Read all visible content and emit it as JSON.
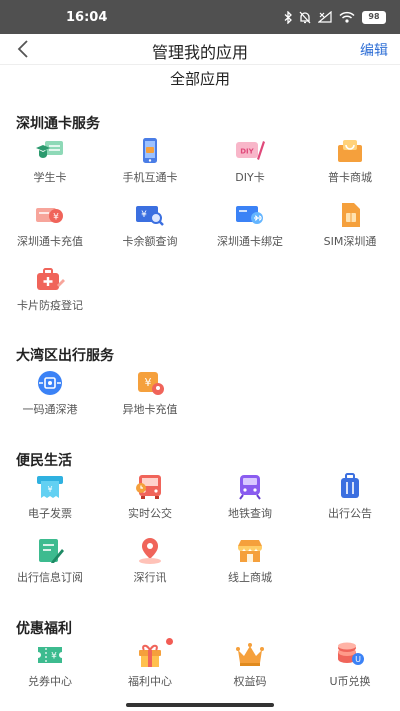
{
  "status_bar": {
    "time": "16:04",
    "battery": "98"
  },
  "nav": {
    "title": "管理我的应用",
    "edit_label": "编辑"
  },
  "page": {
    "heading": "全部应用"
  },
  "sections": [
    {
      "title": "深圳通卡服务",
      "apps": [
        {
          "label": "学生卡",
          "icon": "student-card-icon"
        },
        {
          "label": "手机互通卡",
          "icon": "phone-card-icon"
        },
        {
          "label": "DIY卡",
          "icon": "diy-card-icon"
        },
        {
          "label": "普卡商城",
          "icon": "card-mall-icon"
        },
        {
          "label": "深圳通卡充值",
          "icon": "card-recharge-icon"
        },
        {
          "label": "卡余额查询",
          "icon": "balance-query-icon"
        },
        {
          "label": "深圳通卡绑定",
          "icon": "card-bind-icon"
        },
        {
          "label": "SIM深圳通",
          "icon": "sim-card-icon"
        },
        {
          "label": "卡片防疫登记",
          "icon": "epidemic-register-icon"
        }
      ]
    },
    {
      "title": "大湾区出行服务",
      "apps": [
        {
          "label": "一码通深港",
          "icon": "sz-hk-code-icon"
        },
        {
          "label": "异地卡充值",
          "icon": "remote-recharge-icon"
        }
      ]
    },
    {
      "title": "便民生活",
      "apps": [
        {
          "label": "电子发票",
          "icon": "e-invoice-icon"
        },
        {
          "label": "实时公交",
          "icon": "bus-icon"
        },
        {
          "label": "地铁查询",
          "icon": "metro-icon"
        },
        {
          "label": "出行公告",
          "icon": "travel-notice-icon"
        },
        {
          "label": "出行信息订阅",
          "icon": "subscribe-icon"
        },
        {
          "label": "深行讯",
          "icon": "location-news-icon"
        },
        {
          "label": "线上商城",
          "icon": "online-mall-icon"
        }
      ]
    },
    {
      "title": "优惠福利",
      "apps": [
        {
          "label": "兑券中心",
          "icon": "coupon-icon"
        },
        {
          "label": "福利中心",
          "icon": "gift-icon"
        },
        {
          "label": "权益码",
          "icon": "crown-icon"
        },
        {
          "label": "U币兑换",
          "icon": "coin-icon"
        }
      ]
    }
  ],
  "colors": {
    "accent": "#2f6fd6",
    "orange": "#f5a03c",
    "red": "#f0645a",
    "blue": "#3b82f6",
    "green": "#3dbb8f",
    "purple": "#8a5cf0"
  }
}
